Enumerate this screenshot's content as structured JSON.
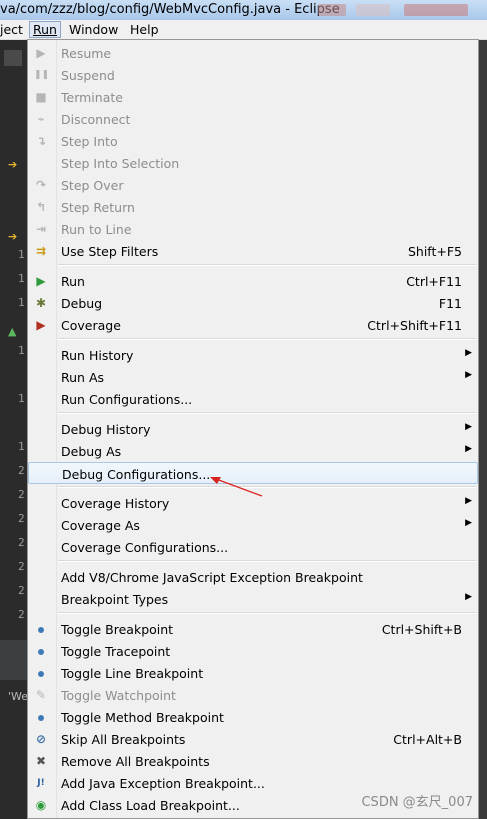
{
  "window": {
    "title": "va/com/zzz/blog/config/WebMvcConfig.java - Eclipse"
  },
  "menubar": {
    "items": [
      "ject",
      "Run",
      "Window",
      "Help"
    ]
  },
  "editor": {
    "line_fragments": [
      "1",
      "1",
      "1",
      "1",
      "1",
      "1",
      "2",
      "2",
      "2",
      "2",
      "2",
      "2",
      "2"
    ],
    "bottom_fragment": "'We"
  },
  "menu": {
    "items": [
      {
        "label": "Resume",
        "shortcut": "",
        "icon": "resume-icon",
        "enabled": false
      },
      {
        "label": "Suspend",
        "shortcut": "",
        "icon": "suspend-icon",
        "enabled": false
      },
      {
        "label": "Terminate",
        "shortcut": "",
        "icon": "terminate-icon",
        "enabled": false
      },
      {
        "label": "Disconnect",
        "shortcut": "",
        "icon": "disconnect-icon",
        "enabled": false
      },
      {
        "label": "Step Into",
        "shortcut": "",
        "icon": "step-into-icon",
        "enabled": false
      },
      {
        "label": "Step Into Selection",
        "shortcut": "",
        "icon": "",
        "enabled": false
      },
      {
        "label": "Step Over",
        "shortcut": "",
        "icon": "step-over-icon",
        "enabled": false
      },
      {
        "label": "Step Return",
        "shortcut": "",
        "icon": "step-return-icon",
        "enabled": false
      },
      {
        "label": "Run to Line",
        "shortcut": "",
        "icon": "run-to-line-icon",
        "enabled": false
      },
      {
        "label": "Use Step Filters",
        "shortcut": "Shift+F5",
        "icon": "step-filters-icon",
        "enabled": true
      },
      {
        "label": "Run",
        "shortcut": "Ctrl+F11",
        "icon": "run-icon",
        "enabled": true
      },
      {
        "label": "Debug",
        "shortcut": "F11",
        "icon": "debug-icon",
        "enabled": true
      },
      {
        "label": "Coverage",
        "shortcut": "Ctrl+Shift+F11",
        "icon": "coverage-icon",
        "enabled": true
      },
      {
        "label": "Run History",
        "shortcut": "",
        "icon": "",
        "enabled": true,
        "submenu": true
      },
      {
        "label": "Run As",
        "shortcut": "",
        "icon": "",
        "enabled": true,
        "submenu": true
      },
      {
        "label": "Run Configurations...",
        "shortcut": "",
        "icon": "",
        "enabled": true
      },
      {
        "label": "Debug History",
        "shortcut": "",
        "icon": "",
        "enabled": true,
        "submenu": true
      },
      {
        "label": "Debug As",
        "shortcut": "",
        "icon": "",
        "enabled": true,
        "submenu": true
      },
      {
        "label": "Debug Configurations...",
        "shortcut": "",
        "icon": "",
        "enabled": true,
        "highlighted": true
      },
      {
        "label": "Coverage History",
        "shortcut": "",
        "icon": "",
        "enabled": true,
        "submenu": true
      },
      {
        "label": "Coverage As",
        "shortcut": "",
        "icon": "",
        "enabled": true,
        "submenu": true
      },
      {
        "label": "Coverage Configurations...",
        "shortcut": "",
        "icon": "",
        "enabled": true
      },
      {
        "label": "Add V8/Chrome JavaScript Exception Breakpoint",
        "shortcut": "",
        "icon": "",
        "enabled": true
      },
      {
        "label": "Breakpoint Types",
        "shortcut": "",
        "icon": "",
        "enabled": true,
        "submenu": true
      },
      {
        "label": "Toggle Breakpoint",
        "shortcut": "Ctrl+Shift+B",
        "icon": "breakpoint-dot-icon",
        "enabled": true
      },
      {
        "label": "Toggle Tracepoint",
        "shortcut": "",
        "icon": "breakpoint-dot-icon",
        "enabled": true
      },
      {
        "label": "Toggle Line Breakpoint",
        "shortcut": "",
        "icon": "breakpoint-dot-icon",
        "enabled": true
      },
      {
        "label": "Toggle Watchpoint",
        "shortcut": "",
        "icon": "watchpoint-icon",
        "enabled": false
      },
      {
        "label": "Toggle Method Breakpoint",
        "shortcut": "",
        "icon": "breakpoint-dot-icon",
        "enabled": true
      },
      {
        "label": "Skip All Breakpoints",
        "shortcut": "Ctrl+Alt+B",
        "icon": "skip-breakpoints-icon",
        "enabled": true
      },
      {
        "label": "Remove All Breakpoints",
        "shortcut": "",
        "icon": "remove-breakpoints-icon",
        "enabled": true
      },
      {
        "label": "Add Java Exception Breakpoint...",
        "shortcut": "",
        "icon": "java-exception-icon",
        "enabled": true
      },
      {
        "label": "Add Class Load Breakpoint...",
        "shortcut": "",
        "icon": "class-load-icon",
        "enabled": true
      }
    ]
  },
  "watermark": "CSDN @玄尺_007",
  "colors": {
    "menu_bg": "#f0f0f0",
    "highlight_border": "#a8c8ea",
    "disabled_text": "#8d8d8d",
    "annotation_arrow": "#d9231f",
    "editor_bg": "#2b2b2b"
  }
}
